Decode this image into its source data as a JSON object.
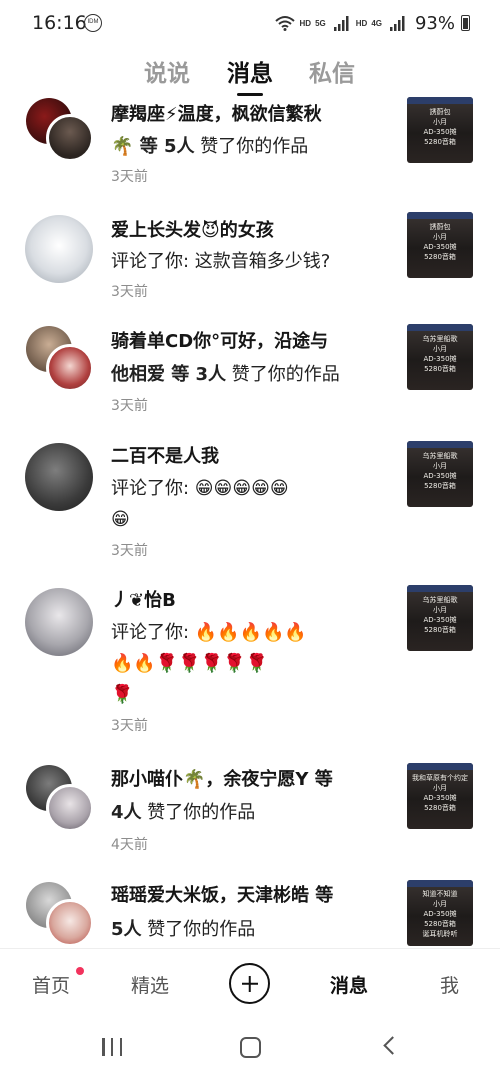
{
  "status": {
    "time": "16:16",
    "idm": "IDM",
    "hd1": "HD",
    "net1": "5G",
    "hd2": "HD",
    "net2": "4G",
    "battery": "93%"
  },
  "tabs": [
    "说说",
    "消息",
    "私信"
  ],
  "active_tab": "消息",
  "items": [
    {
      "title": "摩羯座⚡温度，枫欲信繁秋",
      "line2_emoji": "🌴",
      "line2_bold": " 等 5人",
      "line2": " 赞了你的作品",
      "time": "3天前",
      "thumb_text": [
        "誘蔚包",
        "小月",
        "AD-350摊",
        "5280音箱"
      ]
    },
    {
      "title": "爱上长头发😈的女孩",
      "line2": "评论了你: 这款音箱多少钱?",
      "time": "3天前",
      "thumb_text": [
        "誘蔚包",
        "小月",
        "AD-350摊",
        "5280音箱"
      ]
    },
    {
      "title": "骑着单CD你°可好，沿途与",
      "line2_bold_lead": "他相爱 等 3人",
      "line2": " 赞了你的作品",
      "time": "3天前",
      "thumb_text": [
        "乌苏里船歌",
        "小月",
        "AD-350摊",
        "5280音箱"
      ]
    },
    {
      "title": "二百不是人我",
      "line2": "评论了你: 😁😁😁😁😁",
      "line3": "😁",
      "time": "3天前",
      "thumb_text": [
        "乌苏里船歌",
        "小月",
        "AD-350摊",
        "5280音箱"
      ]
    },
    {
      "title": "丿❦怡B",
      "line2": "评论了你: 🔥🔥🔥🔥🔥",
      "line3": "🔥🔥🌹🌹🌹🌹🌹",
      "line4": "🌹",
      "time": "3天前",
      "thumb_text": [
        "乌苏里船歌",
        "小月",
        "AD-350摊",
        "5280音箱"
      ]
    },
    {
      "title": "那小喵仆🌴，余夜宁愿Y 等",
      "line2_bold_lead": "4人",
      "line2": " 赞了你的作品",
      "time": "4天前",
      "thumb_text": [
        "我和草原有个约定",
        "小月",
        "AD-350摊",
        "5280音箱"
      ]
    },
    {
      "title": "瑶瑶爱大米饭，天津彬皓 等",
      "line2_bold_lead": "5人",
      "line2": " 赞了你的作品",
      "time": "",
      "thumb_text": [
        "知道不知道",
        "小月",
        "AD-350摊",
        "5280音箱",
        "诞耳机聆听"
      ]
    }
  ],
  "bottom_nav": {
    "home": "首页",
    "featured": "精选",
    "messages": "消息",
    "me": "我"
  },
  "colors": {
    "accent_dot": "#f2335d",
    "text_primary": "#161616",
    "text_secondary": "#8d8d8d"
  }
}
